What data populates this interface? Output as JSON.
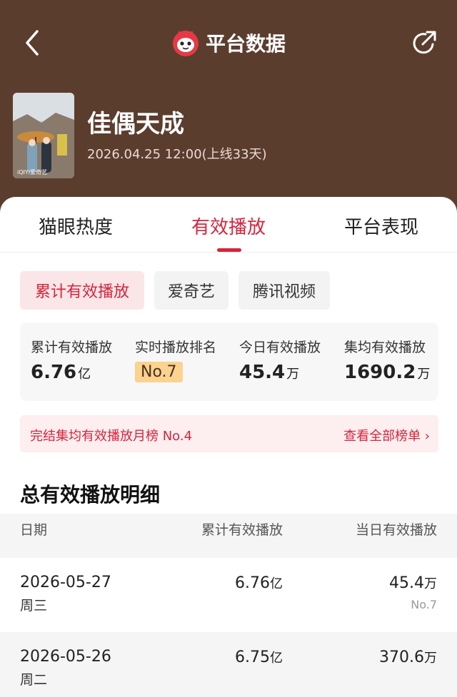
{
  "header": {
    "title": "平台数据",
    "back_icon": "chevron-left-icon",
    "share_icon": "share-icon",
    "logo_icon": "maoyan-cat-icon"
  },
  "movie": {
    "title": "佳偶天成",
    "date_text": "2026.04.25 12:00(上线33天)",
    "poster_brand": "iQIYI爱奇艺"
  },
  "tabs": [
    {
      "label": "猫眼热度",
      "active": false
    },
    {
      "label": "有效播放",
      "active": true
    },
    {
      "label": "平台表现",
      "active": false
    }
  ],
  "chips": [
    {
      "label": "累计有效播放",
      "active": true
    },
    {
      "label": "爱奇艺",
      "active": false
    },
    {
      "label": "腾讯视频",
      "active": false
    }
  ],
  "stats": [
    {
      "label": "累计有效播放",
      "value": "6.76",
      "unit": "亿"
    },
    {
      "label": "实时播放排名",
      "value": "No.7",
      "unit": ""
    },
    {
      "label": "今日有效播放",
      "value": "45.4",
      "unit": "万"
    },
    {
      "label": "集均有效播放",
      "value": "1690.2",
      "unit": "万"
    }
  ],
  "banner": {
    "text": "完结集均有效播放月榜 No.4",
    "link": "查看全部榜单 ›"
  },
  "section": {
    "title": "总有效播放明细"
  },
  "table": {
    "headers": [
      "日期",
      "累计有效播放",
      "当日有效播放"
    ],
    "rows": [
      {
        "date": "2026-05-27",
        "weekday": "周三",
        "cum_value": "6.76",
        "cum_unit": "亿",
        "day_value": "45.4",
        "day_unit": "万",
        "rank": "No.7"
      },
      {
        "date": "2026-05-26",
        "weekday": "周二",
        "cum_value": "6.75",
        "cum_unit": "亿",
        "day_value": "370.6",
        "day_unit": "万",
        "rank": ""
      }
    ]
  },
  "colors": {
    "header_bg": "#5b3d2e",
    "accent": "#d6243d",
    "badge": "#fbd28e"
  }
}
